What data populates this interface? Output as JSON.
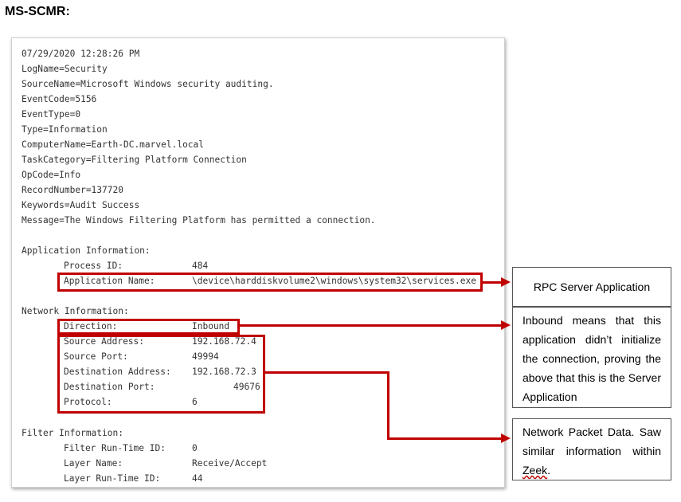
{
  "heading": "MS-SCMR:",
  "log": {
    "timestamp": "07/29/2020 12:28:26 PM",
    "log_name": "LogName=Security",
    "source_name": "SourceName=Microsoft Windows security auditing.",
    "event_code": "EventCode=5156",
    "event_type": "EventType=0",
    "type": "Type=Information",
    "computer_name": "ComputerName=Earth-DC.marvel.local",
    "task_category": "TaskCategory=Filtering Platform Connection",
    "op_code": "OpCode=Info",
    "record_number": "RecordNumber=137720",
    "keywords": "Keywords=Audit Success",
    "message": "Message=The Windows Filtering Platform has permitted a connection.",
    "app_info": {
      "title": "Application Information:",
      "process_id_label": "Process ID:",
      "process_id_value": "484",
      "app_name_label": "Application Name:",
      "app_name_value": "\\device\\harddiskvolume2\\windows\\system32\\services.exe"
    },
    "net_info": {
      "title": "Network Information:",
      "direction_label": "Direction:",
      "direction_value": "Inbound",
      "src_addr_label": "Source Address:",
      "src_addr_value": "192.168.72.4",
      "src_port_label": "Source Port:",
      "src_port_value": "49994",
      "dst_addr_label": "Destination Address:",
      "dst_addr_value": "192.168.72.3",
      "dst_port_label": "Destination Port:",
      "dst_port_value": "49676",
      "protocol_label": "Protocol:",
      "protocol_value": "6"
    },
    "filter_info": {
      "title": "Filter Information:",
      "runtime_label": "Filter Run-Time ID:",
      "runtime_value": "0",
      "layer_name_label": "Layer Name:",
      "layer_name_value": "Receive/Accept",
      "layer_runtime_label": "Layer Run-Time ID:",
      "layer_runtime_value": "44"
    }
  },
  "annotations": {
    "rpc": "RPC Server Application",
    "inbound": "Inbound means that this application didn’t initialize the connection, proving the above that this is the Server Application",
    "packet_main": "Network Packet Data. Saw similar information within ",
    "packet_zeek": "Zeek",
    "packet_tail": "."
  },
  "colors": {
    "highlight": "#c00000",
    "log_text": "#333333"
  }
}
